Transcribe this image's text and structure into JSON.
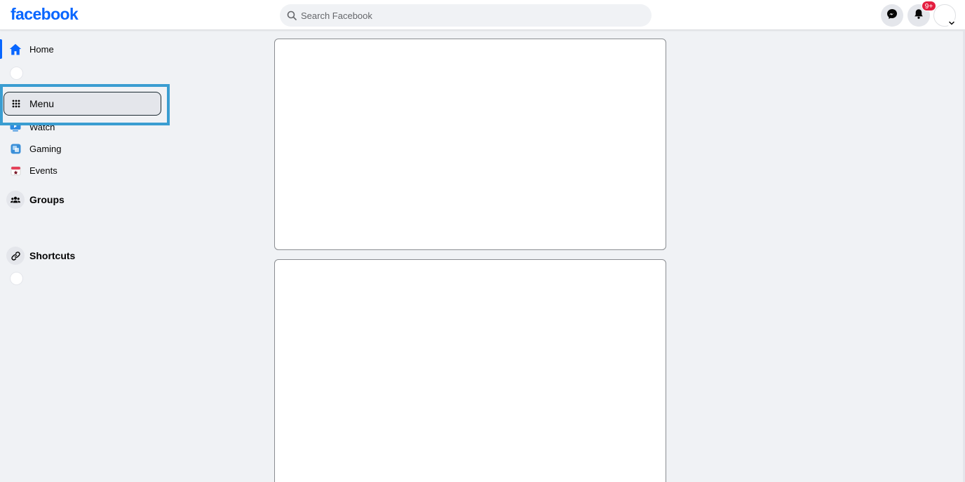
{
  "header": {
    "logo_text": "facebook",
    "search_placeholder": "Search Facebook",
    "notification_badge": "9+"
  },
  "sidebar": {
    "items": [
      {
        "label": "Home",
        "icon": "home-icon"
      },
      {
        "label": "Menu",
        "icon": "grid-menu-icon"
      },
      {
        "label": "Watch",
        "icon": "watch-icon"
      },
      {
        "label": "Gaming",
        "icon": "gaming-icon"
      },
      {
        "label": "Events",
        "icon": "events-icon"
      },
      {
        "label": "Groups",
        "icon": "groups-icon"
      },
      {
        "label": "Shortcuts",
        "icon": "link-icon"
      }
    ]
  },
  "colors": {
    "brand": "#0866ff",
    "highlight_outline": "#3a9dd1",
    "badge": "#e41e3f",
    "background": "#f0f2f5"
  }
}
